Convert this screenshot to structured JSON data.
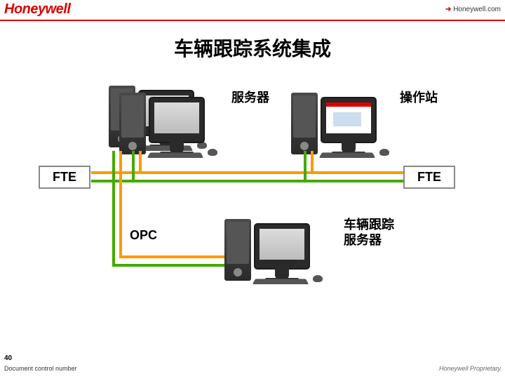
{
  "header": {
    "logo": "Honeywell",
    "site": "Honeywell.com"
  },
  "title": "车辆跟踪系统集成",
  "labels": {
    "server": "服务器",
    "station": "操作站",
    "fte_left": "FTE",
    "fte_right": "FTE",
    "opc": "OPC",
    "tracking_line1": "车辆跟踪",
    "tracking_line2": "服务器"
  },
  "footer": {
    "page": "40",
    "doc": "Document control number",
    "prop": "Honeywell Proprietary"
  },
  "diagram": {
    "nodes": [
      {
        "id": "server",
        "role": "服务器",
        "type": "computer"
      },
      {
        "id": "station",
        "role": "操作站",
        "type": "computer"
      },
      {
        "id": "tracking",
        "role": "车辆跟踪服务器",
        "type": "computer"
      }
    ],
    "buses": [
      {
        "id": "fte-upper",
        "label": "FTE",
        "color": "orange"
      },
      {
        "id": "fte-lower",
        "label": "FTE",
        "color": "green"
      },
      {
        "id": "opc-link",
        "label": "OPC",
        "color": "green+orange"
      }
    ]
  }
}
